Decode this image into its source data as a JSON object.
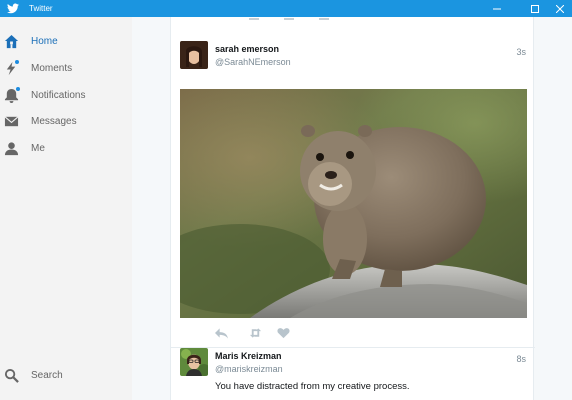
{
  "window": {
    "title": "Twitter",
    "accent": "#1b95e0",
    "logo_icon": "twitter-bird-icon",
    "controls": [
      "minimize-icon",
      "maximize-icon",
      "close-icon"
    ]
  },
  "sidebar": {
    "items": [
      {
        "label": "Home",
        "icon": "home-icon",
        "active": true
      },
      {
        "label": "Moments",
        "icon": "lightning-icon",
        "badge": true
      },
      {
        "label": "Notifications",
        "icon": "bell-icon",
        "badge": true
      },
      {
        "label": "Messages",
        "icon": "envelope-icon"
      },
      {
        "label": "Me",
        "icon": "person-icon"
      }
    ],
    "search": {
      "label": "Search",
      "icon": "search-icon"
    }
  },
  "timeline": {
    "tweets": [
      {
        "name": "sarah emerson",
        "handle": "@SarahNEmerson",
        "time": "3s",
        "media": "rock-hyrax-photo",
        "actions": [
          "reply-icon",
          "retweet-icon",
          "like-icon"
        ]
      },
      {
        "name": "Maris Kreizman",
        "handle": "@mariskreizman",
        "time": "8s",
        "text": "You have distracted from my creative process."
      }
    ]
  }
}
